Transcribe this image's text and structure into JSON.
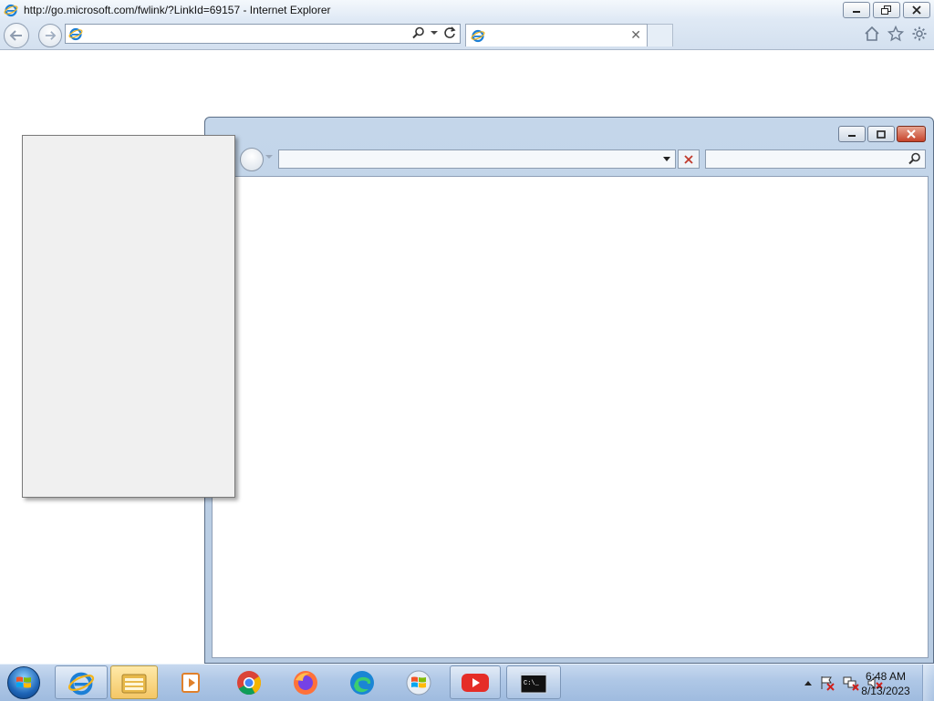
{
  "browser": {
    "window_title": "http://go.microsoft.com/fwlink/?LinkId=69157 - Internet Explorer",
    "address_value": "",
    "tab": {
      "title": ""
    },
    "caption": {
      "minimize": "minimize",
      "restore": "restore",
      "close": "close"
    },
    "toolbar_icons": [
      "home-icon",
      "favorites-star-icon",
      "tools-gear-icon"
    ]
  },
  "child_window": {
    "address_value": "",
    "search_value": ""
  },
  "taskbar": {
    "items": [
      {
        "name": "internet-explorer",
        "icon": "internet-explorer-icon"
      },
      {
        "name": "windows-explorer",
        "icon": "folder-icon"
      },
      {
        "name": "media-player",
        "icon": "media-player-icon"
      },
      {
        "name": "chrome",
        "icon": "chrome-icon"
      },
      {
        "name": "firefox",
        "icon": "firefox-icon"
      },
      {
        "name": "edge",
        "icon": "edge-icon"
      },
      {
        "name": "windows-flag",
        "icon": "windows-flag-icon"
      },
      {
        "name": "youtube",
        "icon": "youtube-icon"
      },
      {
        "name": "command-prompt",
        "icon": "command-prompt-icon"
      }
    ],
    "tray_icons": [
      "action-center-icon",
      "network-icon",
      "volume-muted-icon"
    ],
    "clock": {
      "time": "6:48 AM",
      "date": "8/13/2023"
    },
    "cmd_label": "C:\\_"
  },
  "colors": {
    "taskbar": "#aec7e6",
    "titlebar": "#dfe9f5",
    "close_red": "#c7442b",
    "ie_blue": "#1c7fd6",
    "youtube_red": "#e52d27"
  }
}
